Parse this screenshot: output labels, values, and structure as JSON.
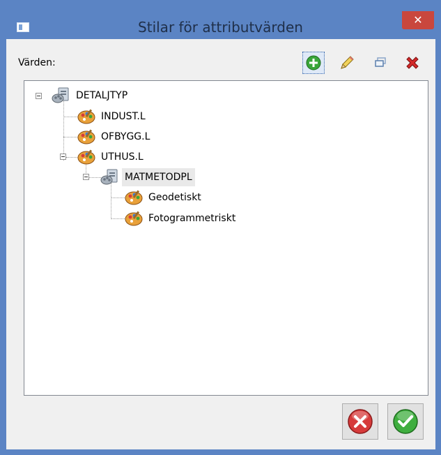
{
  "window": {
    "title": "Stilar för attributvärden"
  },
  "toolbar": {
    "label": "Värden:",
    "buttons": [
      {
        "name": "add",
        "icon": "add-icon",
        "color": "#3aa63a"
      },
      {
        "name": "edit",
        "icon": "pencil-icon",
        "color": "#e8c84a"
      },
      {
        "name": "copy",
        "icon": "copy-icon",
        "color": "#8aa6c9"
      },
      {
        "name": "delete",
        "icon": "delete-icon",
        "color": "#d42a2a"
      }
    ]
  },
  "tree": {
    "items": [
      {
        "label": "DETALJTYP",
        "icon": "attribute-icon",
        "expanded": true
      },
      {
        "label": "INDUST.L",
        "icon": "style-palette-icon"
      },
      {
        "label": "OFBYGG.L",
        "icon": "style-palette-icon"
      },
      {
        "label": "UTHUS.L",
        "icon": "style-palette-icon",
        "expanded": true
      },
      {
        "label": "MATMETODPL",
        "icon": "attribute-icon",
        "expanded": true,
        "selected": true
      },
      {
        "label": "Geodetiskt",
        "icon": "style-palette-icon"
      },
      {
        "label": "Fotogrammetriskt",
        "icon": "style-palette-icon"
      }
    ]
  },
  "footer": {
    "cancel_icon": "cancel-icon",
    "ok_icon": "ok-icon",
    "colors": {
      "cancel": "#d63b3b",
      "ok": "#3fae3f"
    }
  }
}
